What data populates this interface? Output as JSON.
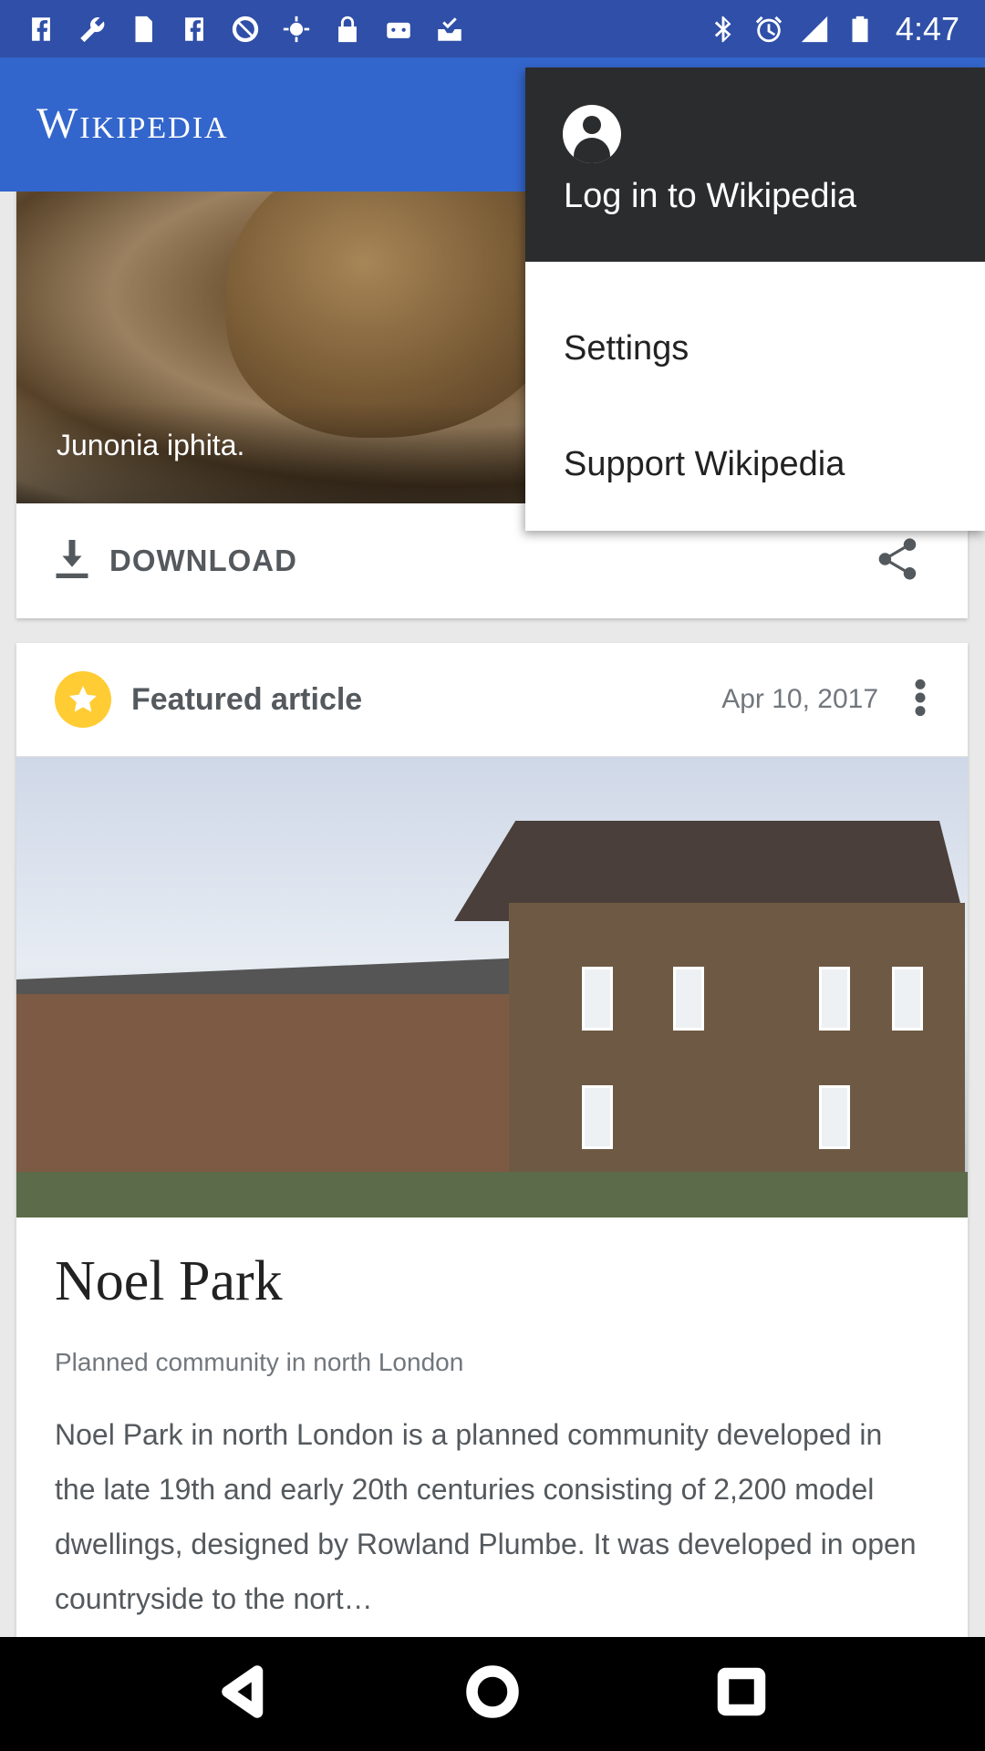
{
  "status_bar": {
    "time": "4:47",
    "left_icons": [
      "facebook-icon",
      "wrench-icon",
      "sim-card-icon",
      "facebook-icon",
      "block-icon",
      "fake-gps-icon",
      "lock-icon",
      "robot-icon",
      "inbox-check-icon"
    ],
    "right_icons": [
      "bluetooth-icon",
      "alarm-icon",
      "signal-icon",
      "battery-icon"
    ]
  },
  "app_bar": {
    "title": "Wikipedia"
  },
  "menu": {
    "login_label": "Log in to Wikipedia",
    "settings_label": "Settings",
    "support_label": "Support Wikipedia"
  },
  "picture_card": {
    "caption": "Junonia iphita.",
    "download_label": "DOWNLOAD"
  },
  "featured_card": {
    "label": "Featured article",
    "date": "Apr 10, 2017",
    "title": "Noel Park",
    "subtitle": "Planned community in north London",
    "extract": "Noel Park in north London is a planned community developed in the late 19th and early 20th centuries consisting of 2,200 model dwellings, designed by Rowland Plumbe. It was developed in open countryside to the nort…"
  },
  "colors": {
    "status_bar": "#2f4fa8",
    "app_bar": "#3366cc",
    "menu_header": "#2b2c2e",
    "star_badge": "#ffcc33"
  }
}
